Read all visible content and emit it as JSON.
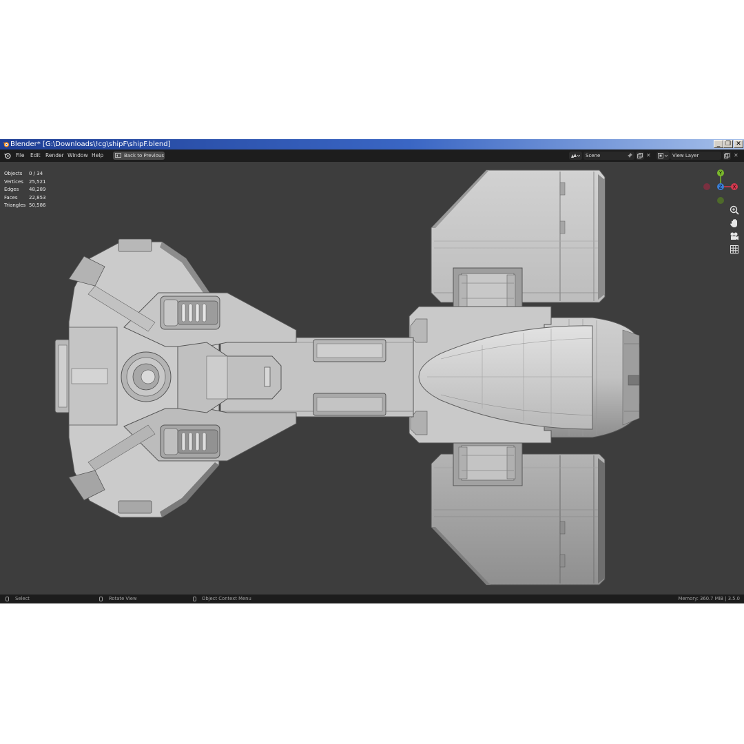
{
  "window": {
    "title": "Blender* [G:\\Downloads\\!cg\\shipF\\shipF.blend]",
    "controls": [
      "_",
      "❐",
      "✕"
    ]
  },
  "menubar": {
    "items": [
      "File",
      "Edit",
      "Render",
      "Window",
      "Help"
    ],
    "back_label": "Back to Previous",
    "scene_label": "Scene",
    "view_layer_label": "View Layer"
  },
  "stats": [
    {
      "label": "Objects",
      "value": "0 / 34"
    },
    {
      "label": "Vertices",
      "value": "25,521"
    },
    {
      "label": "Edges",
      "value": "48,289"
    },
    {
      "label": "Faces",
      "value": "22,853"
    },
    {
      "label": "Triangles",
      "value": "50,586"
    }
  ],
  "gizmo": {
    "axis_y": "Y",
    "axis_z": "Z",
    "axis_x": "X",
    "colors": {
      "x": "#d6394f",
      "y": "#7ab82c",
      "z": "#3a7ed6"
    }
  },
  "statusbar": {
    "select": "Select",
    "rotate": "Rotate View",
    "context": "Object Context Menu",
    "memory": "Memory: 360.7 MiB | 3.5.0"
  },
  "colors": {
    "viewport_bg": "#3d3d3d",
    "model_light": "#c9c9c9",
    "model_mid": "#a8a8a8",
    "model_dark": "#6a6a6a"
  }
}
